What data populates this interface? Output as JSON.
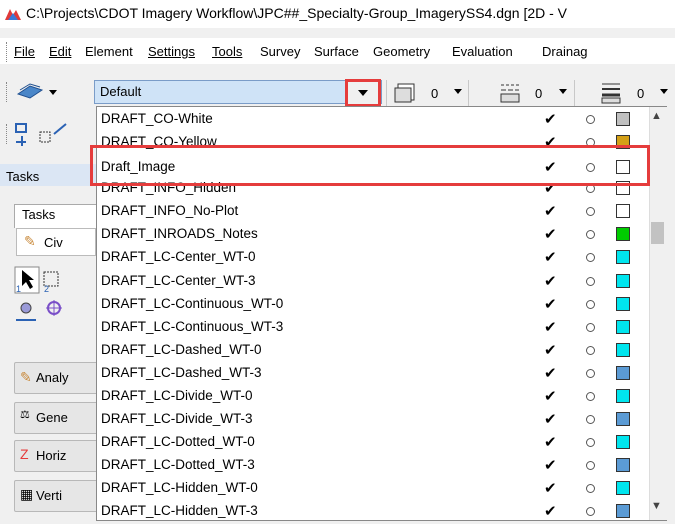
{
  "window": {
    "title": "C:\\Projects\\CDOT Imagery Workflow\\JPC##_Specialty-Group_ImagerySS4.dgn [2D - V"
  },
  "menu": [
    {
      "label": "File"
    },
    {
      "label": "Edit"
    },
    {
      "label": "Element"
    },
    {
      "label": "Settings"
    },
    {
      "label": "Tools"
    },
    {
      "label": "Survey"
    },
    {
      "label": "Surface"
    },
    {
      "label": "Geometry"
    },
    {
      "label": "Evaluation"
    },
    {
      "label": "Drainag"
    }
  ],
  "toolbar": {
    "level_combo_value": "Default",
    "counts": [
      "0",
      "0",
      "0"
    ]
  },
  "left_panel": {
    "tasks_header": "Tasks",
    "tasks_tab": "Tasks",
    "civ_label": "Civ",
    "buttons": [
      {
        "label": "Analy",
        "icon": "analysis-icon"
      },
      {
        "label": "Gene",
        "icon": "general-icon"
      },
      {
        "label": "Horiz",
        "icon": "horizontal-icon"
      },
      {
        "label": "Verti",
        "icon": "vertical-icon"
      }
    ]
  },
  "level_list": {
    "rows": [
      {
        "name": "DRAFT_CO-White",
        "on": "✔",
        "swatch": "#c0c0c0"
      },
      {
        "name": "DRAFT_CO-Yellow",
        "on": "✔",
        "swatch": "#d4a017"
      },
      {
        "name": "Draft_Image",
        "on": "✔",
        "swatch": "#ffffff",
        "selected": true
      },
      {
        "name": "DRAFT_INFO_Hidden",
        "on": "✔",
        "swatch": "#ffffff"
      },
      {
        "name": "DRAFT_INFO_No-Plot",
        "on": "✔",
        "swatch": "#ffffff"
      },
      {
        "name": "DRAFT_INROADS_Notes",
        "on": "✔",
        "swatch": "#00cc00"
      },
      {
        "name": "DRAFT_LC-Center_WT-0",
        "on": "✔",
        "swatch": "#00e5ee"
      },
      {
        "name": "DRAFT_LC-Center_WT-3",
        "on": "✔",
        "swatch": "#00e5ee"
      },
      {
        "name": "DRAFT_LC-Continuous_WT-0",
        "on": "✔",
        "swatch": "#00e5ee"
      },
      {
        "name": "DRAFT_LC-Continuous_WT-3",
        "on": "✔",
        "swatch": "#00e5ee"
      },
      {
        "name": "DRAFT_LC-Dashed_WT-0",
        "on": "✔",
        "swatch": "#00e5ee"
      },
      {
        "name": "DRAFT_LC-Dashed_WT-3",
        "on": "✔",
        "swatch": "#5b9bd5"
      },
      {
        "name": "DRAFT_LC-Divide_WT-0",
        "on": "✔",
        "swatch": "#00e5ee"
      },
      {
        "name": "DRAFT_LC-Divide_WT-3",
        "on": "✔",
        "swatch": "#5b9bd5"
      },
      {
        "name": "DRAFT_LC-Dotted_WT-0",
        "on": "✔",
        "swatch": "#00e5ee"
      },
      {
        "name": "DRAFT_LC-Dotted_WT-3",
        "on": "✔",
        "swatch": "#5b9bd5"
      },
      {
        "name": "DRAFT_LC-Hidden_WT-0",
        "on": "✔",
        "swatch": "#00e5ee"
      },
      {
        "name": "DRAFT_LC-Hidden_WT-3",
        "on": "✔",
        "swatch": "#5b9bd5"
      }
    ]
  },
  "colors": {
    "highlight": "#e53c3c",
    "combo_bg": "#cfe3f7"
  }
}
